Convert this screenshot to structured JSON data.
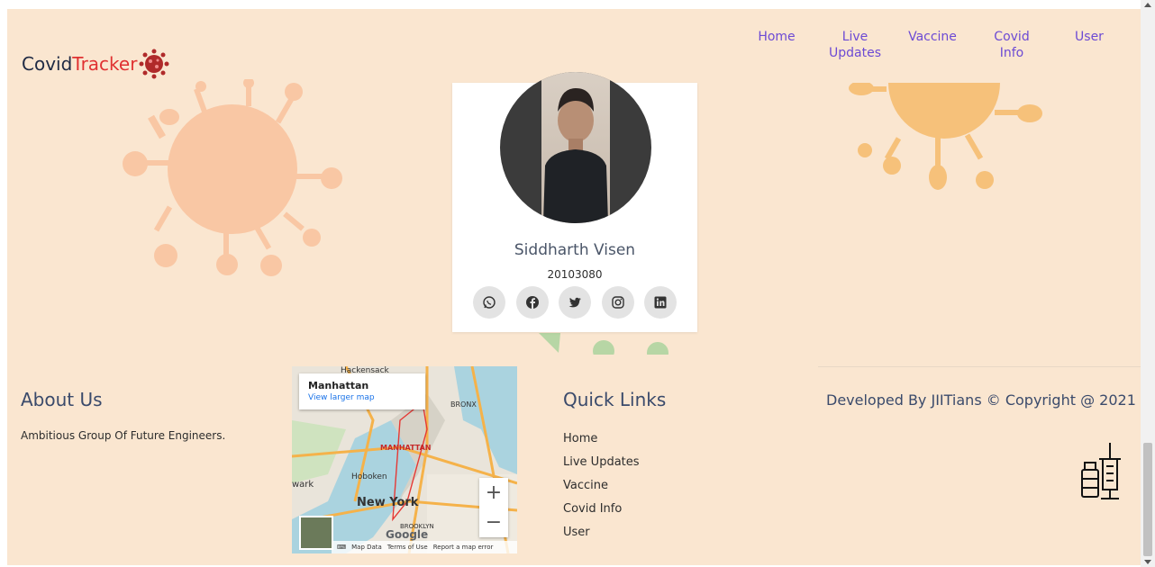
{
  "brand": {
    "part1": "Covid",
    "part2": "Tracker"
  },
  "nav": {
    "home": "Home",
    "live": "Live Updates",
    "vaccine": "Vaccine",
    "covid_info": "Covid Info",
    "user": "User"
  },
  "profile": {
    "name": "Siddharth Visen",
    "roll": "20103080",
    "socials": [
      "whatsapp-icon",
      "facebook-icon",
      "twitter-icon",
      "instagram-icon",
      "linkedin-icon"
    ]
  },
  "about": {
    "title": "About Us",
    "text": "Ambitious Group Of Future Engineers."
  },
  "map": {
    "popup_title": "Manhattan",
    "popup_link": "View larger map",
    "labels": [
      "Hackensack",
      "BRONX",
      "MANHATTAN",
      "Hoboken",
      "New York",
      "BROOKLYN",
      "wark"
    ],
    "footer": [
      "Map Data",
      "Terms of Use",
      "Report a map error"
    ],
    "logo": "Google"
  },
  "quick_links": {
    "title": "Quick Links",
    "items": [
      "Home",
      "Live Updates",
      "Vaccine",
      "Covid Info",
      "User"
    ]
  },
  "footer": {
    "developed": "Developed By JIITians © Copyright @ 2021"
  },
  "colors": {
    "background": "#fae6d0",
    "nav_link": "#6c4ad4",
    "brand_red": "#e03131",
    "virus_left": "#f9c7a4",
    "virus_right": "#f6c17a"
  }
}
